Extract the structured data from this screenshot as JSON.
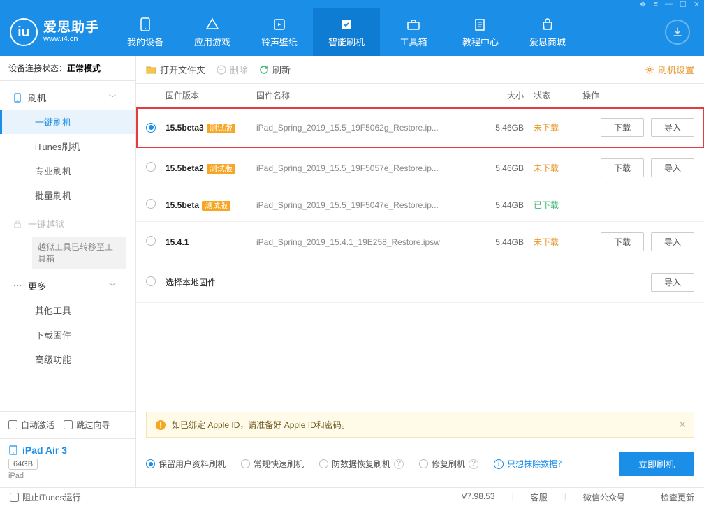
{
  "titlebar": {
    "icons": [
      "cards",
      "menu",
      "min",
      "max",
      "close"
    ]
  },
  "logo": {
    "title": "爱思助手",
    "sub": "www.i4.cn"
  },
  "nav": [
    {
      "label": "我的设备"
    },
    {
      "label": "应用游戏"
    },
    {
      "label": "铃声壁纸"
    },
    {
      "label": "智能刷机",
      "active": true
    },
    {
      "label": "工具箱"
    },
    {
      "label": "教程中心"
    },
    {
      "label": "爱思商城"
    }
  ],
  "sidebar": {
    "status_label": "设备连接状态：",
    "status_value": "正常模式",
    "flash_group": "刷机",
    "items": [
      {
        "label": "一键刷机",
        "active": true
      },
      {
        "label": "iTunes刷机"
      },
      {
        "label": "专业刷机"
      },
      {
        "label": "批量刷机"
      }
    ],
    "jailbreak": "一键越狱",
    "jailbreak_note": "越狱工具已转移至工具箱",
    "more": "更多",
    "more_items": [
      {
        "label": "其他工具"
      },
      {
        "label": "下载固件"
      },
      {
        "label": "高级功能"
      }
    ],
    "auto_activate": "自动激活",
    "skip_guide": "跳过向导",
    "device_name": "iPad Air 3",
    "device_cap": "64GB",
    "device_type": "iPad"
  },
  "toolbar": {
    "open": "打开文件夹",
    "del": "删除",
    "refresh": "刷新",
    "settings": "刷机设置"
  },
  "columns": {
    "ver": "固件版本",
    "name": "固件名称",
    "size": "大小",
    "status": "状态",
    "ops": "操作"
  },
  "firmwares": [
    {
      "ver": "15.5beta3",
      "beta": true,
      "name": "iPad_Spring_2019_15.5_19F5062g_Restore.ip...",
      "size": "5.46GB",
      "status": "未下载",
      "st_class": "st-no",
      "selected": true,
      "download": true,
      "import": true,
      "highlight": true
    },
    {
      "ver": "15.5beta2",
      "beta": true,
      "name": "iPad_Spring_2019_15.5_19F5057e_Restore.ip...",
      "size": "5.46GB",
      "status": "未下载",
      "st_class": "st-no",
      "download": true,
      "import": true
    },
    {
      "ver": "15.5beta",
      "beta": true,
      "name": "iPad_Spring_2019_15.5_19F5047e_Restore.ip...",
      "size": "5.44GB",
      "status": "已下载",
      "st_class": "st-yes"
    },
    {
      "ver": "15.4.1",
      "beta": false,
      "name": "iPad_Spring_2019_15.4.1_19E258_Restore.ipsw",
      "size": "5.44GB",
      "status": "未下载",
      "st_class": "st-no",
      "download": true,
      "import": true
    },
    {
      "ver": "选择本地固件",
      "local": true,
      "import": true
    }
  ],
  "btn": {
    "download": "下载",
    "import": "导入"
  },
  "badge_text": "测试版",
  "notice": "如已绑定 Apple ID，请准备好 Apple ID和密码。",
  "options": [
    {
      "label": "保留用户资料刷机",
      "selected": true
    },
    {
      "label": "常规快速刷机"
    },
    {
      "label": "防数据恢复刷机",
      "help": true
    },
    {
      "label": "修复刷机",
      "help": true
    }
  ],
  "erase_link": "只想抹除数据？",
  "flash_now": "立即刷机",
  "footer": {
    "block_itunes": "阻止iTunes运行",
    "version": "V7.98.53",
    "kefu": "客服",
    "wechat": "微信公众号",
    "update": "检查更新"
  }
}
